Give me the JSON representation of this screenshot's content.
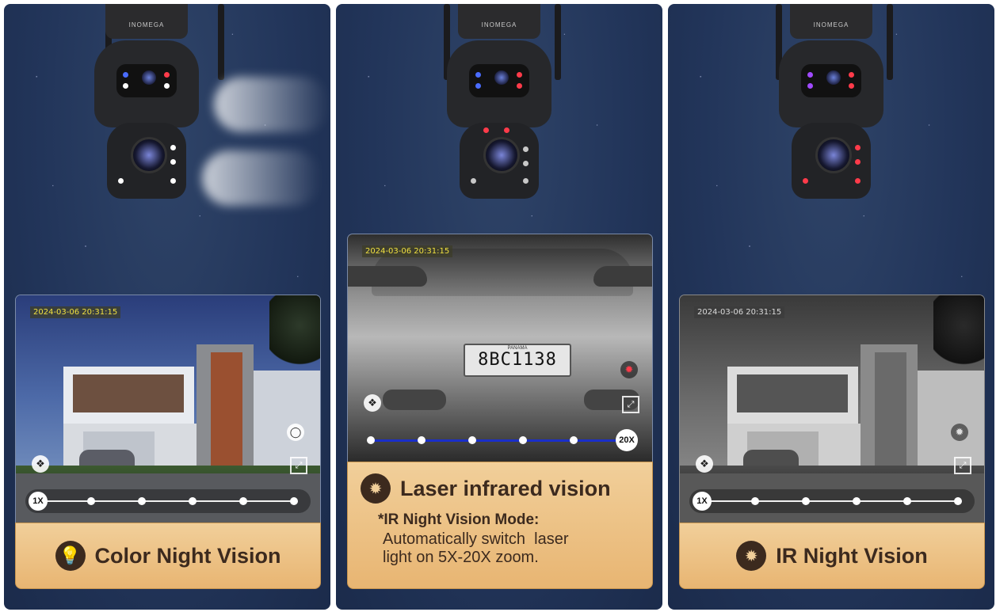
{
  "brand": "INOMEGA",
  "panels": [
    {
      "timestamp": "2024-03-06 20:31:15",
      "zoom_label": "1X",
      "caption_title": "Color Night Vision",
      "caption_icon": "lightbulb-icon"
    },
    {
      "timestamp": "2024-03-06 20:31:15",
      "zoom_label": "20X",
      "plate": "8BC1138",
      "plate_country": "PANAMA",
      "caption_title": "Laser infrared vision",
      "caption_icon": "laser-dots-icon",
      "caption_note_title": "*IR Night Vision Mode:",
      "caption_note_line1": "Automatically switch  laser",
      "caption_note_line2": "light on 5X-20X zoom."
    },
    {
      "timestamp": "2024-03-06 20:31:15",
      "zoom_label": "1X",
      "caption_title": "IR Night Vision",
      "caption_icon": "ir-dots-icon"
    }
  ],
  "colors": {
    "caption_bg": "#edc080",
    "caption_text": "#3c2a1e",
    "sky": "#22355a",
    "zoom_track_blue": "#1a2fc8"
  }
}
